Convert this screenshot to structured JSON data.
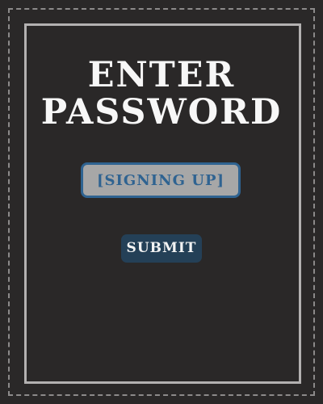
{
  "title": {
    "line1": "ENTER",
    "line2": "PASSWORD"
  },
  "password_field": {
    "placeholder": "[SIGNING UP]"
  },
  "submit": {
    "label": "SUBMIT"
  },
  "colors": {
    "background": "#2a2828",
    "field_fill": "#a7a7a7",
    "field_accent": "#2f6391",
    "button_fill": "#244057",
    "text": "#f7f7f7"
  }
}
